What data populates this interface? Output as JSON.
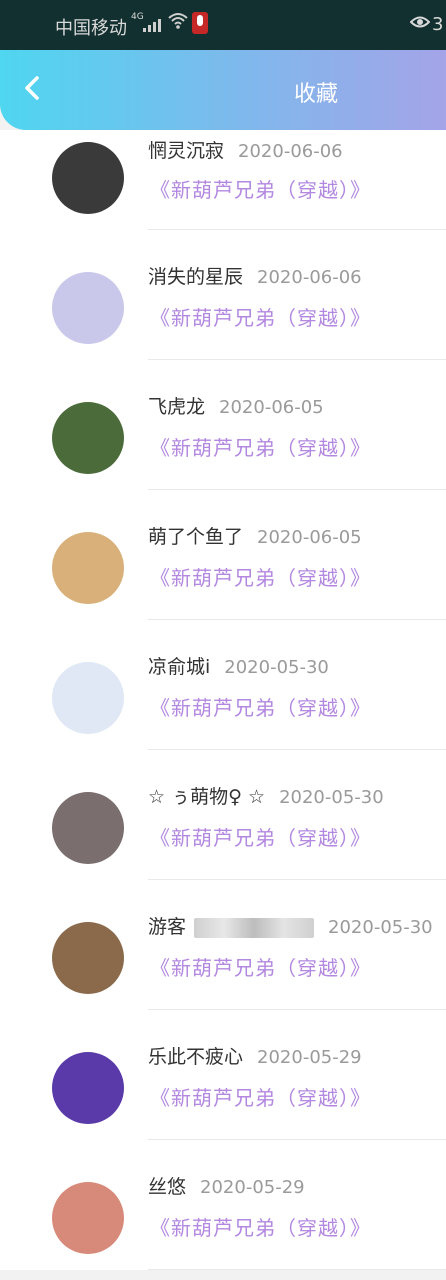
{
  "status_bar": {
    "carrier": "中国移动",
    "network": "4G",
    "eye_count": "3"
  },
  "header": {
    "title": "收藏"
  },
  "favorites": [
    {
      "name": "惘灵沉寂",
      "date": "2020-06-06",
      "book": "《新葫芦兄弟（穿越）》",
      "avatar_color": "#3a3a3a"
    },
    {
      "name": "消失的星辰",
      "date": "2020-06-06",
      "book": "《新葫芦兄弟（穿越）》",
      "avatar_color": "#c9c7ea"
    },
    {
      "name": "飞虎龙",
      "date": "2020-06-05",
      "book": "《新葫芦兄弟（穿越）》",
      "avatar_color": "#4b6b3a"
    },
    {
      "name": "萌了个鱼了",
      "date": "2020-06-05",
      "book": "《新葫芦兄弟（穿越）》",
      "avatar_color": "#d9b07a"
    },
    {
      "name": "凉俞城i",
      "date": "2020-05-30",
      "book": "《新葫芦兄弟（穿越）》",
      "avatar_color": "#dfe8f4"
    },
    {
      "name": "☆ ぅ萌物♀ ☆",
      "date": "2020-05-30",
      "book": "《新葫芦兄弟（穿越）》",
      "avatar_color": "#7a6e6e"
    },
    {
      "name": "游客",
      "date": "2020-05-30",
      "book": "《新葫芦兄弟（穿越）》",
      "avatar_color": "#8a6a4a"
    },
    {
      "name": "乐此不疲心",
      "date": "2020-05-29",
      "book": "《新葫芦兄弟（穿越）》",
      "avatar_color": "#5a3aa8"
    },
    {
      "name": "丝悠",
      "date": "2020-05-29",
      "book": "《新葫芦兄弟（穿越）》",
      "avatar_color": "#d88a7a"
    }
  ]
}
